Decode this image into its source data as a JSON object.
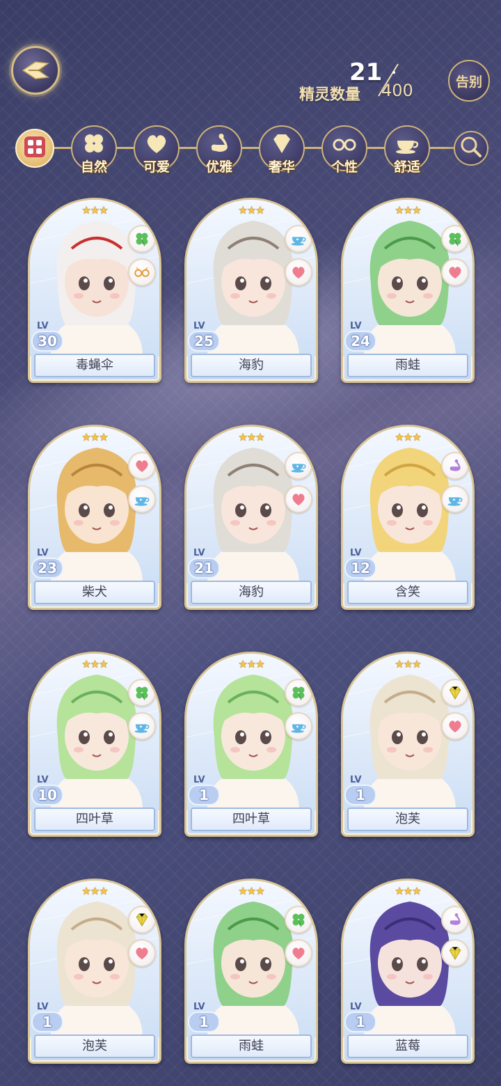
{
  "header": {
    "spirit_count_label": "精灵数量",
    "spirit_count_current": "21",
    "spirit_count_max": "400",
    "farewell_label": "告别"
  },
  "filters": [
    {
      "key": "all",
      "label": "",
      "icon": "grid-icon"
    },
    {
      "key": "nature",
      "label": "自然",
      "icon": "clover-icon"
    },
    {
      "key": "cute",
      "label": "可爱",
      "icon": "heart-icon"
    },
    {
      "key": "elegant",
      "label": "优雅",
      "icon": "swan-icon"
    },
    {
      "key": "luxury",
      "label": "奢华",
      "icon": "diamond-icon"
    },
    {
      "key": "personality",
      "label": "个性",
      "icon": "glasses-icon"
    },
    {
      "key": "comfort",
      "label": "舒适",
      "icon": "teacup-icon"
    },
    {
      "key": "search",
      "label": "",
      "icon": "search-icon"
    }
  ],
  "lv_tag": "LV",
  "spirits": [
    {
      "name": "毒蝇伞",
      "level": "30",
      "stars": "★★★",
      "traits": [
        "clover-icon",
        "glasses-icon"
      ],
      "palette": [
        "#f2efee",
        "#c8302e",
        "#f7e2d8"
      ]
    },
    {
      "name": "海豹",
      "level": "25",
      "stars": "★★★",
      "traits": [
        "teacup-icon",
        "heart-icon"
      ],
      "palette": [
        "#e0dcd6",
        "#8f8075",
        "#f8e6dc"
      ]
    },
    {
      "name": "雨蛙",
      "level": "24",
      "stars": "★★★",
      "traits": [
        "clover-icon",
        "heart-icon"
      ],
      "palette": [
        "#8fd18a",
        "#4c9a4b",
        "#f6e6d8"
      ]
    },
    {
      "name": "柴犬",
      "level": "23",
      "stars": "★★★",
      "traits": [
        "heart-icon",
        "teacup-icon"
      ],
      "palette": [
        "#e7b96b",
        "#b9843c",
        "#f8e4d0"
      ]
    },
    {
      "name": "海豹",
      "level": "21",
      "stars": "★★★",
      "traits": [
        "teacup-icon",
        "heart-icon"
      ],
      "palette": [
        "#e0dcd6",
        "#8f8075",
        "#f8e6dc"
      ]
    },
    {
      "name": "含笑",
      "level": "12",
      "stars": "★★★",
      "traits": [
        "swan-icon",
        "teacup-icon"
      ],
      "palette": [
        "#f2d47a",
        "#d0a542",
        "#f8e6da"
      ]
    },
    {
      "name": "四叶草",
      "level": "10",
      "stars": "★★★",
      "traits": [
        "clover-icon",
        "teacup-icon"
      ],
      "palette": [
        "#b5e39a",
        "#6bb05c",
        "#f8e8dc"
      ]
    },
    {
      "name": "四叶草",
      "level": "1",
      "stars": "★★★",
      "traits": [
        "clover-icon",
        "teacup-icon"
      ],
      "palette": [
        "#b5e39a",
        "#6bb05c",
        "#f8e8dc"
      ]
    },
    {
      "name": "泡芙",
      "level": "1",
      "stars": "★★★",
      "traits": [
        "diamond-icon",
        "heart-icon"
      ],
      "palette": [
        "#ede3d1",
        "#c4ad8a",
        "#f8e6d8"
      ]
    },
    {
      "name": "泡芙",
      "level": "1",
      "stars": "★★★",
      "traits": [
        "diamond-icon",
        "heart-icon"
      ],
      "palette": [
        "#ede3d1",
        "#c4ad8a",
        "#f8e6d8"
      ]
    },
    {
      "name": "雨蛙",
      "level": "1",
      "stars": "★★★",
      "traits": [
        "clover-icon",
        "heart-icon"
      ],
      "palette": [
        "#8fd18a",
        "#4c9a4b",
        "#f6e6d8"
      ]
    },
    {
      "name": "蓝莓",
      "level": "1",
      "stars": "★★★",
      "traits": [
        "swan-icon",
        "diamond-icon"
      ],
      "palette": [
        "#5a4aa0",
        "#3a2f77",
        "#f6e2dc"
      ]
    }
  ]
}
